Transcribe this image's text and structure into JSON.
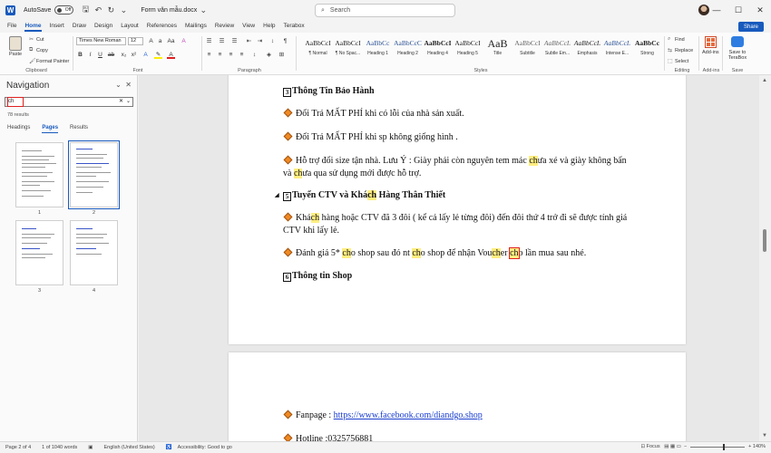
{
  "titlebar": {
    "autosave_label": "AutoSave",
    "autosave_state": "Off",
    "doc_title": "Form văn mẫu.docx",
    "search_placeholder": "Search"
  },
  "menu": {
    "items": [
      "File",
      "Home",
      "Insert",
      "Draw",
      "Design",
      "Layout",
      "References",
      "Mailings",
      "Review",
      "View",
      "Help",
      "Terabox"
    ],
    "active": "Home",
    "share": "Share"
  },
  "ribbon": {
    "clipboard": {
      "paste": "Paste",
      "cut": "Cut",
      "copy": "Copy",
      "format_painter": "Format Painter",
      "label": "Clipboard"
    },
    "font": {
      "family": "Times New Roman",
      "size": "12",
      "label": "Font"
    },
    "paragraph": {
      "label": "Paragraph"
    },
    "styles": {
      "items": [
        {
          "sample": "AaBbCcI",
          "name": "¶ Normal"
        },
        {
          "sample": "AaBbCcI",
          "name": "¶ No Spac..."
        },
        {
          "sample": "AaBbCc",
          "name": "Heading 1"
        },
        {
          "sample": "AaBbCcC",
          "name": "Heading 2"
        },
        {
          "sample": "AaBbCcI",
          "name": "Heading 4"
        },
        {
          "sample": "AaBbCcI",
          "name": "Heading 5"
        },
        {
          "sample": "AaB",
          "name": "Title"
        },
        {
          "sample": "AaBbCcI",
          "name": "Subtitle"
        },
        {
          "sample": "AaBbCcL",
          "name": "Subtle Em..."
        },
        {
          "sample": "AaBbCcL",
          "name": "Emphasis"
        },
        {
          "sample": "AaBbCcL",
          "name": "Intense E..."
        },
        {
          "sample": "AaBbCc",
          "name": "Strong"
        }
      ],
      "label": "Styles"
    },
    "editing": {
      "find": "Find",
      "replace": "Replace",
      "select": "Select",
      "label": "Editing"
    },
    "addins": {
      "label": "Add-ins",
      "name": "Add-ins"
    },
    "save": {
      "name": "Save to TeraBox",
      "label": "Save"
    }
  },
  "nav": {
    "title": "Navigation",
    "query": "ch",
    "results": "78 results",
    "tabs": [
      "Headings",
      "Pages",
      "Results"
    ],
    "active_tab": "Pages",
    "pages": [
      "1",
      "2",
      "3",
      "4"
    ],
    "selected_page": "2"
  },
  "doc": {
    "h3": "Thông Tin Bảo Hành",
    "l1": "Đổi Trả MẤT PHÍ khi có lỗi của nhà sản xuất.",
    "l2": "Đổi Trả MẤT PHÍ khi sp không giống hình .",
    "l3a": "Hỗ trợ đổi size tận nhà. Lưu Ý : Giày phải còn nguyên tem mác ",
    "l3b": "ch",
    "l3c": "ưa xé và giày không bẩn",
    "l4a": "và ",
    "l4b": "ch",
    "l4c": "ưa qua sử dụng mới được hỗ trợ.",
    "h5a": "Tuyển CTV và Khá",
    "h5b": "ch",
    "h5c": " Hàng Thân Thiết",
    "l5a": "Khá",
    "l5b": "ch",
    "l5c": " hàng hoặc CTV đã 3 đôi ( kể cả lấy lẻ từng đôi) đến đôi thứ 4 trở đi sẽ được tính giá",
    "l6": "CTV khi lấy lẻ.",
    "l7a": "Đánh giá 5* ",
    "l7b": "ch",
    "l7c": "o shop sau đó nt ",
    "l7d": "ch",
    "l7e": "o shop để nhận Vou",
    "l7f": "ch",
    "l7g": "er ",
    "l7h": "ch",
    "l7i": "o lần mua sau nhé.",
    "h6": "Thông tin Shop",
    "fb_label": "Fanpage : ",
    "fb_link": "https://www.facebook.com/diandgo.shop",
    "hotline": "Hotline :0325756881"
  },
  "status": {
    "page": "Page 2 of 4",
    "words": "1 of 1040 words",
    "lang": "English (United States)",
    "access": "Accessibility: Good to go",
    "focus": "Focus",
    "zoom": "140%"
  }
}
